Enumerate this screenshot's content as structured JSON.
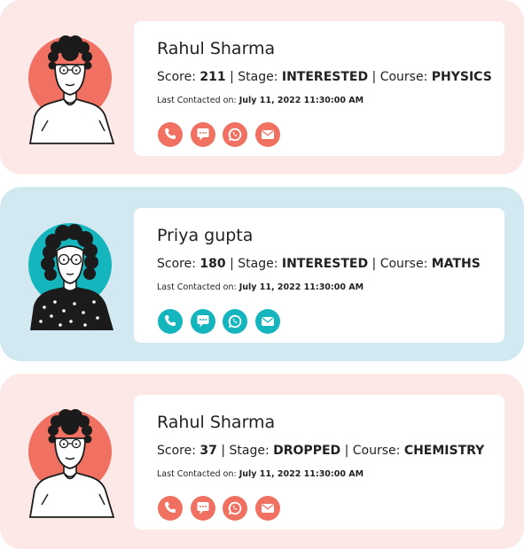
{
  "colors": {
    "coral": "#f07161",
    "teal": "#14b5bd",
    "coral_bg": "#fde8e8",
    "teal_bg": "#d3e9f2"
  },
  "labels": {
    "score": "Score:",
    "stage": "Stage:",
    "course": "Course:",
    "last_contacted": "Last Contacted on:",
    "separator": "|"
  },
  "action_icons": [
    "phone-icon",
    "chat-icon",
    "whatsapp-icon",
    "email-icon"
  ],
  "leads": [
    {
      "name": "Rahul Sharma",
      "score": "211",
      "stage": "INTERESTED",
      "course": "PHYSICS",
      "last_contacted": "July 11, 2022 11:30:00 AM",
      "accent": "coral"
    },
    {
      "name": "Priya gupta",
      "score": "180",
      "stage": "INTERESTED",
      "course": "MATHS",
      "last_contacted": "July 11, 2022 11:30:00 AM",
      "accent": "teal"
    },
    {
      "name": "Rahul Sharma",
      "score": "37",
      "stage": "DROPPED",
      "course": "CHEMISTRY",
      "last_contacted": "July 11, 2022 11:30:00 AM",
      "accent": "coral"
    }
  ]
}
